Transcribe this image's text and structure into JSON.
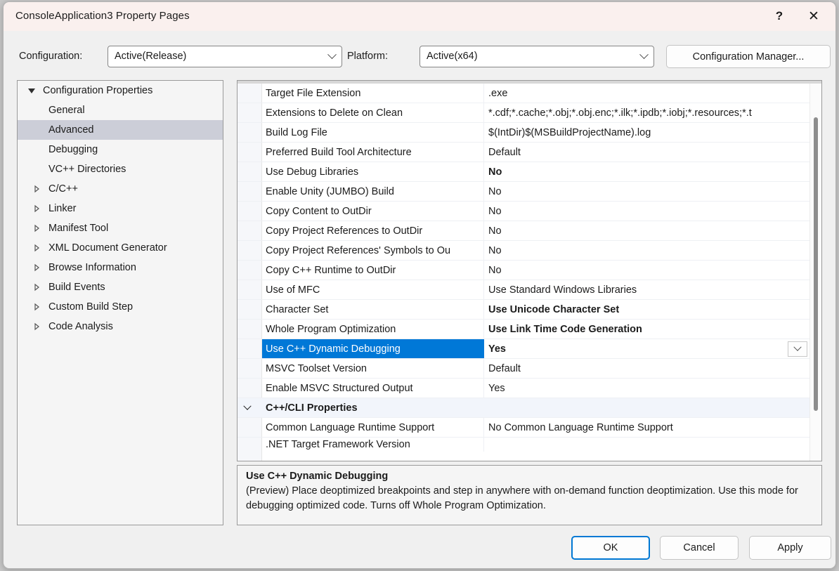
{
  "window": {
    "title": "ConsoleApplication3 Property Pages",
    "help_icon": "question-mark-icon",
    "close_icon": "close-icon",
    "titlebar_color": "#faf0ee",
    "body_color": "#f0f0f0"
  },
  "toolbar": {
    "configuration_label": "Configuration:",
    "configuration_value": "Active(Release)",
    "platform_label": "Platform:",
    "platform_value": "Active(x64)",
    "configuration_manager_label": "Configuration Manager..."
  },
  "tree": {
    "selected": "Advanced",
    "selection_color": "#ccced8",
    "items": [
      {
        "label": "Configuration Properties",
        "level": 0,
        "glyph": "triangle-down-icon"
      },
      {
        "label": "General",
        "level": 1,
        "glyph": "none"
      },
      {
        "label": "Advanced",
        "level": 1,
        "glyph": "none",
        "selected": true
      },
      {
        "label": "Debugging",
        "level": 1,
        "glyph": "none"
      },
      {
        "label": "VC++ Directories",
        "level": 1,
        "glyph": "none"
      },
      {
        "label": "C/C++",
        "level": 1,
        "glyph": "triangle-right-icon"
      },
      {
        "label": "Linker",
        "level": 1,
        "glyph": "triangle-right-icon"
      },
      {
        "label": "Manifest Tool",
        "level": 1,
        "glyph": "triangle-right-icon"
      },
      {
        "label": "XML Document Generator",
        "level": 1,
        "glyph": "triangle-right-icon"
      },
      {
        "label": "Browse Information",
        "level": 1,
        "glyph": "triangle-right-icon"
      },
      {
        "label": "Build Events",
        "level": 1,
        "glyph": "triangle-right-icon"
      },
      {
        "label": "Custom Build Step",
        "level": 1,
        "glyph": "triangle-right-icon"
      },
      {
        "label": "Code Analysis",
        "level": 1,
        "glyph": "triangle-right-icon"
      }
    ]
  },
  "grid": {
    "selection_color": "#0078d7",
    "scrollbar": {
      "thumb_color": "#8d8d8d"
    },
    "rows": [
      {
        "name": "Target File Extension",
        "value": ".exe",
        "bold": false
      },
      {
        "name": "Extensions to Delete on Clean",
        "value": "*.cdf;*.cache;*.obj;*.obj.enc;*.ilk;*.ipdb;*.iobj;*.resources;*.t",
        "bold": false
      },
      {
        "name": "Build Log File",
        "value": "$(IntDir)$(MSBuildProjectName).log",
        "bold": false
      },
      {
        "name": "Preferred Build Tool Architecture",
        "value": "Default",
        "bold": false
      },
      {
        "name": "Use Debug Libraries",
        "value": "No",
        "bold": true
      },
      {
        "name": "Enable Unity (JUMBO) Build",
        "value": "No",
        "bold": false
      },
      {
        "name": "Copy Content to OutDir",
        "value": "No",
        "bold": false
      },
      {
        "name": "Copy Project References to OutDir",
        "value": "No",
        "bold": false
      },
      {
        "name": "Copy Project References' Symbols to Ou",
        "value": "No",
        "bold": false
      },
      {
        "name": "Copy C++ Runtime to OutDir",
        "value": "No",
        "bold": false
      },
      {
        "name": "Use of MFC",
        "value": "Use Standard Windows Libraries",
        "bold": false
      },
      {
        "name": "Character Set",
        "value": "Use Unicode Character Set",
        "bold": true
      },
      {
        "name": "Whole Program Optimization",
        "value": "Use Link Time Code Generation",
        "bold": true
      },
      {
        "name": "Use C++ Dynamic Debugging",
        "value": "Yes",
        "bold": true,
        "selected": true,
        "dropdown": true,
        "dropdown_icon": "chevron-down-icon"
      },
      {
        "name": "MSVC Toolset Version",
        "value": "Default",
        "bold": false
      },
      {
        "name": "Enable MSVC Structured Output",
        "value": "Yes",
        "bold": false
      },
      {
        "name": "C++/CLI Properties",
        "value": "",
        "group": true,
        "glyph": "chevron-down-icon"
      },
      {
        "name": "Common Language Runtime Support",
        "value": "No Common Language Runtime Support",
        "bold": false
      },
      {
        "name": ".NET Target Framework Version",
        "value": "",
        "bold": false,
        "clipped": true
      }
    ]
  },
  "description": {
    "title": "Use C++ Dynamic Debugging",
    "body": "(Preview) Place deoptimized breakpoints and step in anywhere with on-demand function deoptimization. Use this mode for debugging optimized code. Turns off Whole Program Optimization."
  },
  "footer": {
    "ok_label": "OK",
    "cancel_label": "Cancel",
    "apply_label": "Apply",
    "default_button_border": "#0078d4"
  }
}
